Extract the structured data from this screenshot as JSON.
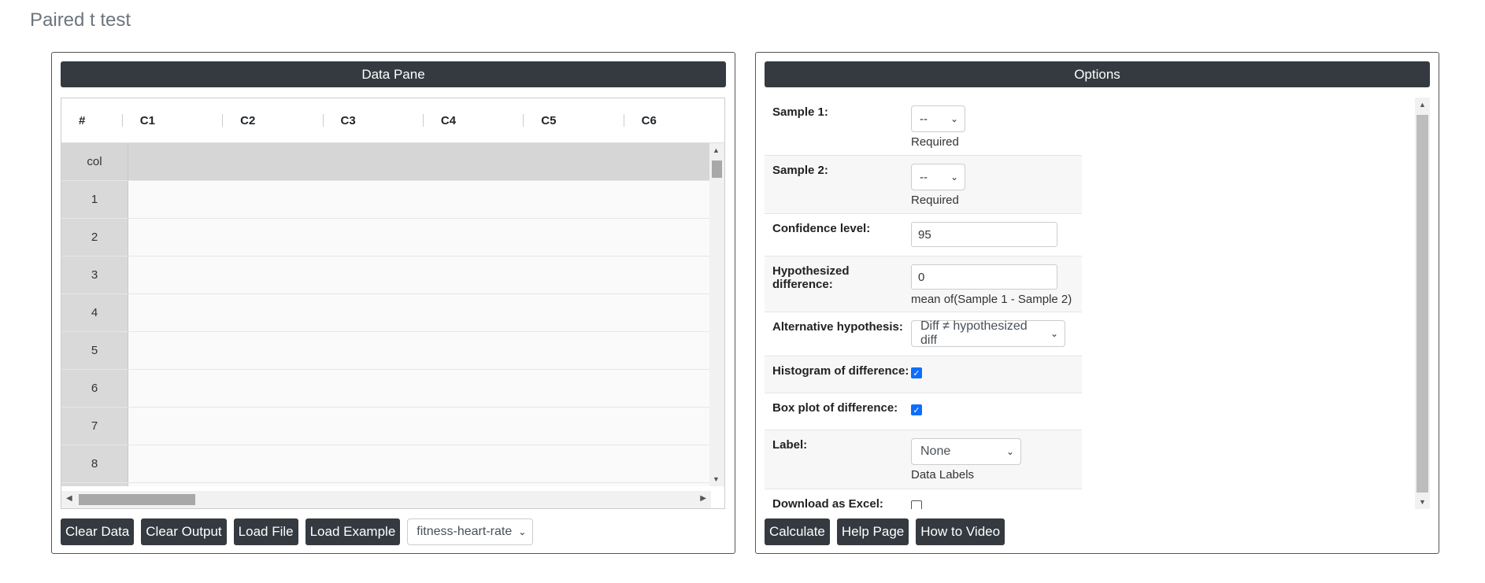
{
  "page": {
    "title": "Paired t test"
  },
  "data_pane": {
    "header": "Data Pane",
    "columns": [
      "#",
      "C1",
      "C2",
      "C3",
      "C4",
      "C5",
      "C6"
    ],
    "rows": [
      "col",
      "1",
      "2",
      "3",
      "4",
      "5",
      "6",
      "7",
      "8"
    ],
    "buttons": {
      "clear_data": "Clear Data",
      "clear_output": "Clear Output",
      "load_file": "Load File",
      "load_example": "Load Example"
    },
    "example_select": "fitness-heart-rate"
  },
  "options": {
    "header": "Options",
    "sample1": {
      "label": "Sample 1:",
      "value": "--",
      "note": "Required"
    },
    "sample2": {
      "label": "Sample 2:",
      "value": "--",
      "note": "Required"
    },
    "confidence": {
      "label": "Confidence level:",
      "value": "95"
    },
    "hypothesized": {
      "label": "Hypothesized difference:",
      "value": "0",
      "note": "mean of(Sample 1 - Sample 2)"
    },
    "alternative": {
      "label": "Alternative hypothesis:",
      "value": "Diff ≠ hypothesized diff"
    },
    "histogram": {
      "label": "Histogram of difference:",
      "checked": true
    },
    "boxplot": {
      "label": "Box plot of difference:",
      "checked": true
    },
    "label_opt": {
      "label": "Label:",
      "value": "None",
      "note": "Data Labels"
    },
    "download": {
      "label": "Download as Excel:",
      "checked": false
    },
    "buttons": {
      "calculate": "Calculate",
      "help": "Help Page",
      "video": "How to Video"
    }
  },
  "colors": {
    "dark": "#343a40",
    "accent": "#0d6efd"
  }
}
